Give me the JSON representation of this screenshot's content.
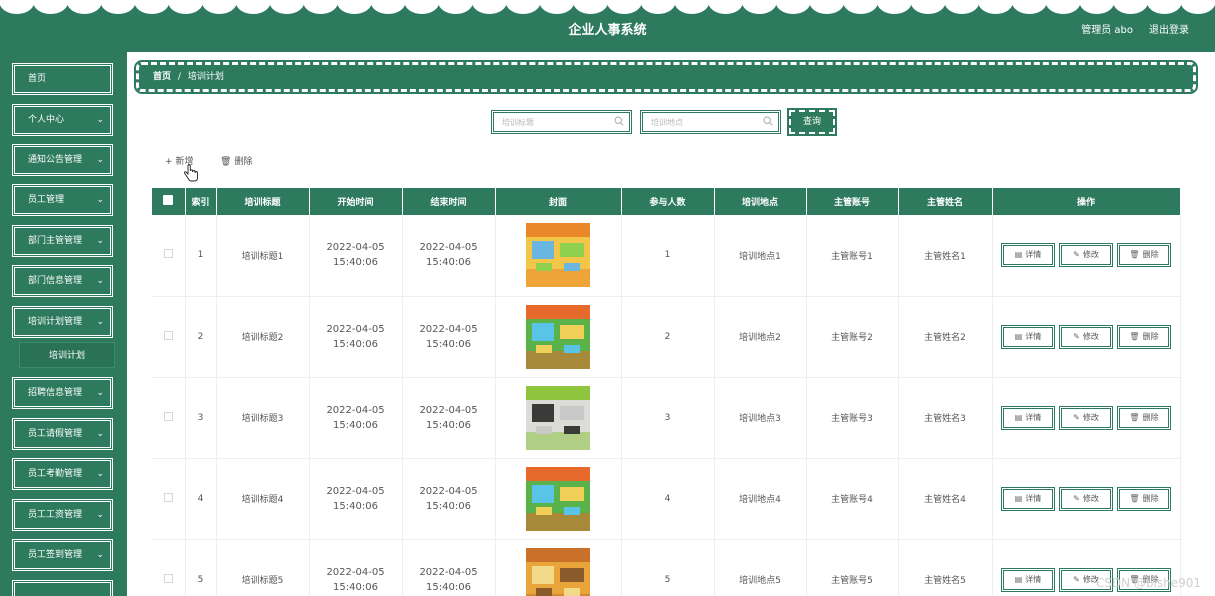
{
  "header": {
    "title": "企业人事系统",
    "admin_label": "管理员 abo",
    "logout_label": "退出登录"
  },
  "sidebar": {
    "items": [
      {
        "label": "首页",
        "has_arrow": false
      },
      {
        "label": "个人中心",
        "has_arrow": true
      },
      {
        "label": "通知公告管理",
        "has_arrow": true
      },
      {
        "label": "员工管理",
        "has_arrow": true
      },
      {
        "label": "部门主管管理",
        "has_arrow": true
      },
      {
        "label": "部门信息管理",
        "has_arrow": true
      },
      {
        "label": "培训计划管理",
        "has_arrow": true
      },
      {
        "label": "招聘信息管理",
        "has_arrow": true
      },
      {
        "label": "员工请假管理",
        "has_arrow": true
      },
      {
        "label": "员工考勤管理",
        "has_arrow": true
      },
      {
        "label": "员工工资管理",
        "has_arrow": true
      },
      {
        "label": "员工签到管理",
        "has_arrow": true
      }
    ],
    "active_sub": "培训计划"
  },
  "breadcrumb": {
    "home": "首页",
    "separator": "/",
    "current": "培训计划"
  },
  "search": {
    "title_placeholder": "培训标题",
    "location_placeholder": "培训地点",
    "query_label": "查询"
  },
  "toolbar": {
    "add_label": "新增",
    "delete_label": "删除"
  },
  "table": {
    "headers": [
      "索引",
      "培训标题",
      "开始时间",
      "结束时间",
      "封面",
      "参与人数",
      "培训地点",
      "主管账号",
      "主管姓名",
      "操作"
    ],
    "actions": {
      "detail": "详情",
      "edit": "修改",
      "delete": "删除"
    },
    "rows": [
      {
        "index": "1",
        "title": "培训标题1",
        "start": "2022-04-05 15:40:06",
        "end": "2022-04-05 15:40:06",
        "cover": "classroom-yellow",
        "count": "1",
        "location": "培训地点1",
        "account": "主管账号1",
        "name": "主管姓名1"
      },
      {
        "index": "2",
        "title": "培训标题2",
        "start": "2022-04-05 15:40:06",
        "end": "2022-04-05 15:40:06",
        "cover": "classroom-green",
        "count": "2",
        "location": "培训地点2",
        "account": "主管账号2",
        "name": "主管姓名2"
      },
      {
        "index": "3",
        "title": "培训标题3",
        "start": "2022-04-05 15:40:06",
        "end": "2022-04-05 15:40:06",
        "cover": "classroom-desks",
        "count": "3",
        "location": "培训地点3",
        "account": "主管账号3",
        "name": "主管姓名3"
      },
      {
        "index": "4",
        "title": "培训标题4",
        "start": "2022-04-05 15:40:06",
        "end": "2022-04-05 15:40:06",
        "cover": "classroom-green",
        "count": "4",
        "location": "培训地点4",
        "account": "主管账号4",
        "name": "主管姓名4"
      },
      {
        "index": "5",
        "title": "培训标题5",
        "start": "2022-04-05 15:40:06",
        "end": "2022-04-05 15:40:06",
        "cover": "classroom-warm",
        "count": "5",
        "location": "培训地点5",
        "account": "主管账号5",
        "name": "主管姓名5"
      }
    ]
  },
  "watermark": "CSDN @bishe901",
  "colors": {
    "primary": "#2d7a5e",
    "border": "#ffffff"
  }
}
